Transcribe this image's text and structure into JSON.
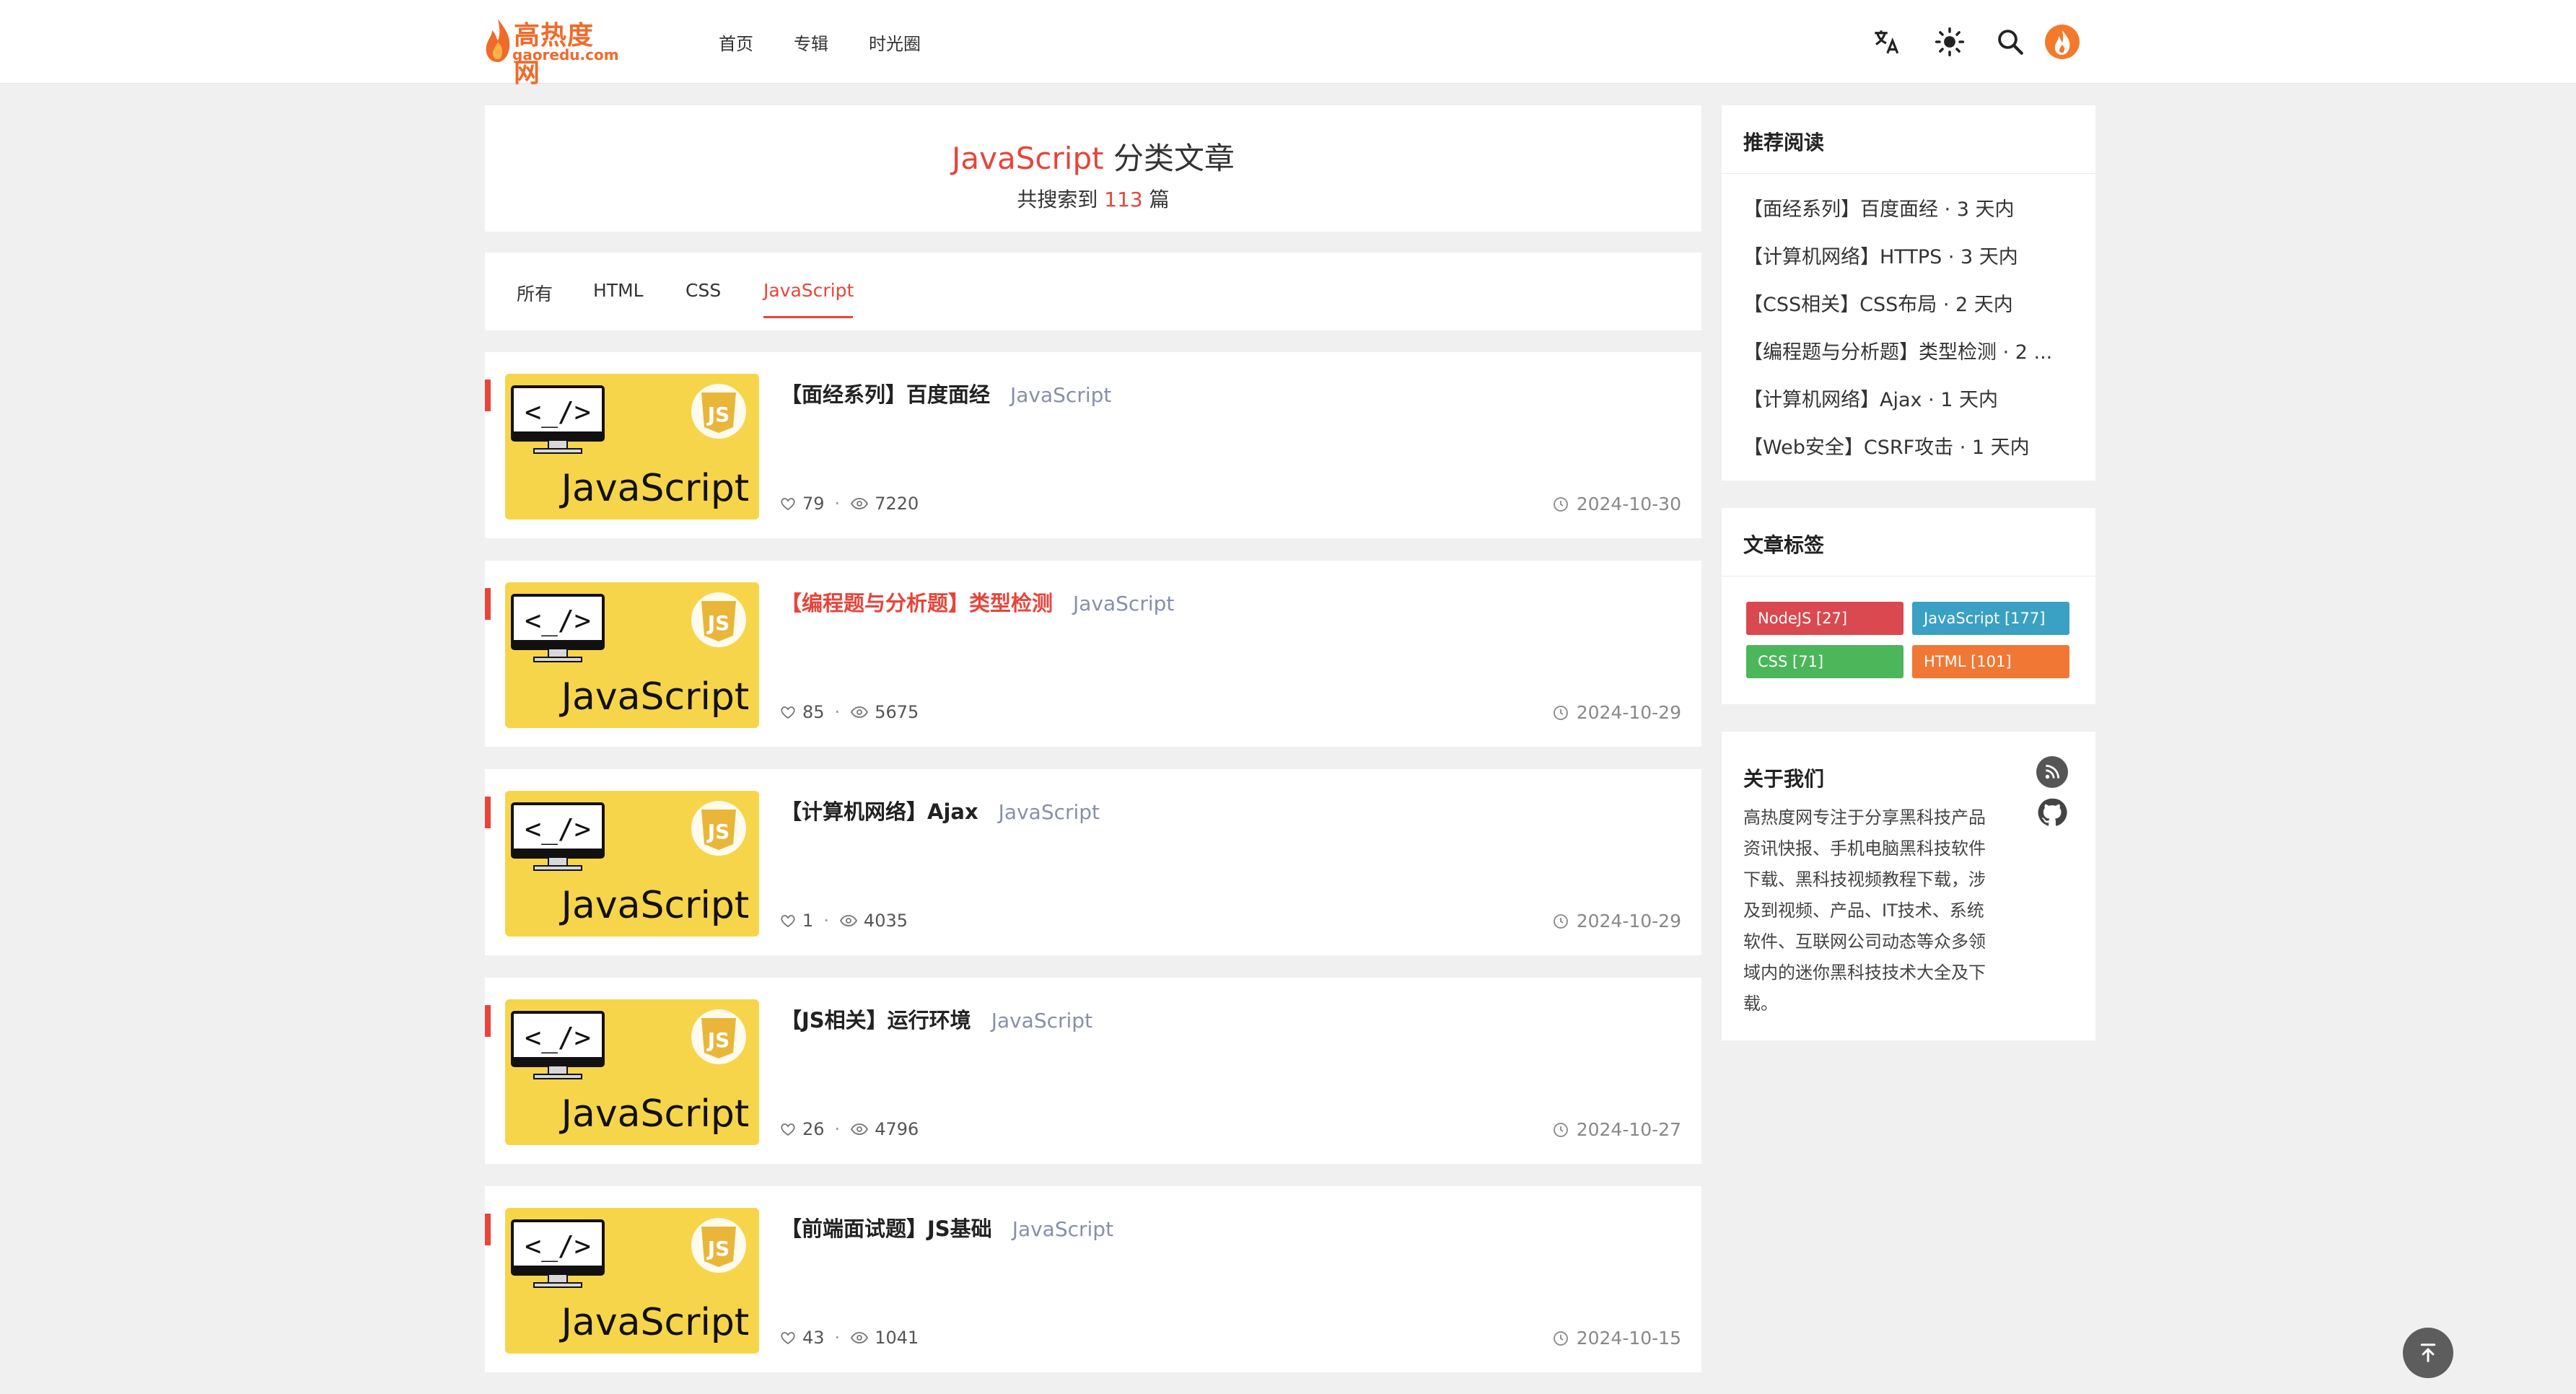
{
  "header": {
    "logo_cn": "高热度网",
    "logo_en": "gaoredu.com",
    "nav": [
      "首页",
      "专辑",
      "时光圈"
    ],
    "icons": [
      "translate-icon",
      "sun-icon",
      "search-icon",
      "flame-avatar-icon"
    ]
  },
  "title": {
    "category": "JavaScript",
    "suffix": " 分类文章",
    "count_prefix": "共搜索到 ",
    "count": "113",
    "count_suffix": " 篇"
  },
  "tabs": {
    "items": [
      "所有",
      "HTML",
      "CSS",
      "JavaScript"
    ],
    "active": "JavaScript"
  },
  "posts": [
    {
      "title": "【面经系列】百度面经",
      "category": "JavaScript",
      "likes": "79",
      "views": "7220",
      "date": "2024-10-30",
      "thumb_text": "JavaScript",
      "highlight": false
    },
    {
      "title": "【编程题与分析题】类型检测",
      "category": "JavaScript",
      "likes": "85",
      "views": "5675",
      "date": "2024-10-29",
      "thumb_text": "JavaScript",
      "highlight": true
    },
    {
      "title": "【计算机网络】Ajax",
      "category": "JavaScript",
      "likes": "1",
      "views": "4035",
      "date": "2024-10-29",
      "thumb_text": "JavaScript",
      "highlight": false
    },
    {
      "title": "【JS相关】运行环境",
      "category": "JavaScript",
      "likes": "26",
      "views": "4796",
      "date": "2024-10-27",
      "thumb_text": "JavaScript",
      "highlight": false
    },
    {
      "title": "【前端面试题】JS基础",
      "category": "JavaScript",
      "likes": "43",
      "views": "1041",
      "date": "2024-10-15",
      "thumb_text": "JavaScript",
      "highlight": false
    }
  ],
  "thumb_code": "<_/>",
  "thumb_badge": "JS",
  "sidebar": {
    "recommend_title": "推荐阅读",
    "recommend": [
      "【面经系列】百度面经 · 3 天内",
      "【计算机网络】HTTPS · 3 天内",
      "【CSS相关】CSS布局 · 2 天内",
      "【编程题与分析题】类型检测 · 2 ...",
      "【计算机网络】Ajax · 1 天内",
      "【Web安全】CSRF攻击 · 1 天内"
    ],
    "tags_title": "文章标签",
    "tags": [
      {
        "label": "NodeJS [27]",
        "color": "#d9494f"
      },
      {
        "label": "JavaScript [177]",
        "color": "#3aa0c4"
      },
      {
        "label": "CSS [71]",
        "color": "#4cb65a"
      },
      {
        "label": "HTML [101]",
        "color": "#f07834"
      }
    ],
    "about_title": "关于我们",
    "about_text": "高热度网专注于分享黑科技产品资讯快报、手机电脑黑科技软件下载、黑科技视频教程下载，涉及到视频、产品、IT技术、系统软件、互联网公司动态等众多领域内的迷你黑科技技术大全及下载。",
    "about_icons": [
      "rss-icon",
      "github-icon"
    ]
  },
  "colors": {
    "accent": "#e8443a",
    "thumb_bg": "#f7d54a",
    "page_bg": "#f0f0f0"
  }
}
